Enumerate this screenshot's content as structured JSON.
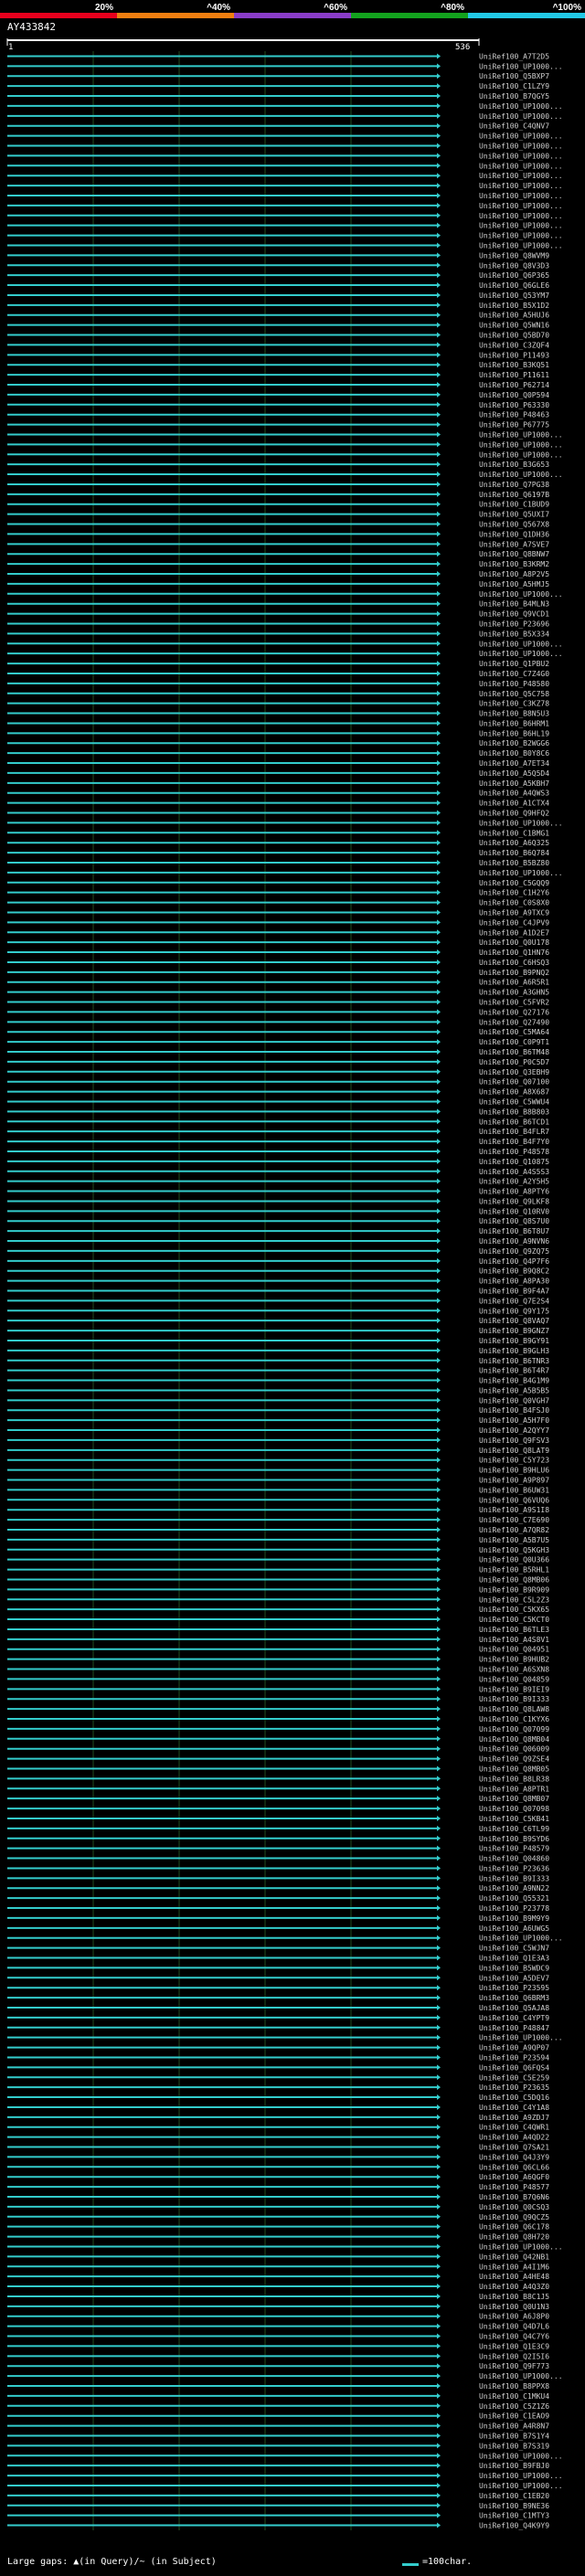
{
  "header": {
    "query_name": "AY433842",
    "scale_ticks": [
      "20%",
      "^40%",
      "^60%",
      "^80%",
      "^100%"
    ],
    "scale_colors": [
      "#e8001d",
      "#f07f10",
      "#8a3cc8",
      "#13a31e",
      "#22c9e6"
    ],
    "ruler_start": "1",
    "ruler_end": "536"
  },
  "legend": {
    "text": "Large gaps: ▲(in Query)/~ (in Subject)",
    "scale_label": "=100char."
  },
  "hits": [
    "UniRef100_A7T2D5",
    "UniRef100_UP1000...",
    "UniRef100_Q5BXP7",
    "UniRef100_C1LZY9",
    "UniRef100_B7QGY5",
    "UniRef100_UP1000...",
    "UniRef100_UP1000...",
    "UniRef100_C4QNV7",
    "UniRef100_UP1000...",
    "UniRef100_UP1000...",
    "UniRef100_UP1000...",
    "UniRef100_UP1000...",
    "UniRef100_UP1000...",
    "UniRef100_UP1000...",
    "UniRef100_UP1000...",
    "UniRef100_UP1000...",
    "UniRef100_UP1000...",
    "UniRef100_UP1000...",
    "UniRef100_UP1000...",
    "UniRef100_UP1000...",
    "UniRef100_Q8WVM9",
    "UniRef100_Q8V3D3",
    "UniRef100_Q6P365",
    "UniRef100_Q6GLE6",
    "UniRef100_Q53YM7",
    "UniRef100_B5X1D2",
    "UniRef100_A5HUJ6",
    "UniRef100_Q5WN16",
    "UniRef100_Q5BD70",
    "UniRef100_C3ZQF4",
    "UniRef100_P11493",
    "UniRef100_B3KQ51",
    "UniRef100_P11611",
    "UniRef100_P62714",
    "UniRef100_Q0P594",
    "UniRef100_P63330",
    "UniRef100_P48463",
    "UniRef100_P67775",
    "UniRef100_UP1000...",
    "UniRef100_UP1000...",
    "UniRef100_UP1000...",
    "UniRef100_B3G653",
    "UniRef100_UP1000...",
    "UniRef100_Q7PG38",
    "UniRef100_Q6197B",
    "UniRef100_C1BUD9",
    "UniRef100_Q5UXI7",
    "UniRef100_Q567X8",
    "UniRef100_Q1DH36",
    "UniRef100_A7SVE7",
    "UniRef100_Q8BNW7",
    "UniRef100_B3KRM2",
    "UniRef100_A8P2V5",
    "UniRef100_A5HMJ5",
    "UniRef100_UP1000...",
    "UniRef100_B4MLN3",
    "UniRef100_Q9VCD1",
    "UniRef100_P23696",
    "UniRef100_B5X334",
    "UniRef100_UP1000...",
    "UniRef100_UP1000...",
    "UniRef100_Q1PBU2",
    "UniRef100_C7Z4G0",
    "UniRef100_P48580",
    "UniRef100_Q5C758",
    "UniRef100_C3KZ78",
    "UniRef100_B8N5U3",
    "UniRef100_B6HRM1",
    "UniRef100_B6HL19",
    "UniRef100_B2WGG6",
    "UniRef100_B0Y8C6",
    "UniRef100_A7ET34",
    "UniRef100_A5Q5D4",
    "UniRef100_A5KBH7",
    "UniRef100_A4QWS3",
    "UniRef100_A1CTX4",
    "UniRef100_Q9HFQ2",
    "UniRef100_UP1000...",
    "UniRef100_C1BMG1",
    "UniRef100_A6Q325",
    "UniRef100_B6Q784",
    "UniRef100_B5BZ80",
    "UniRef100_UP1000...",
    "UniRef100_C5GQQ9",
    "UniRef100_C1H2Y6",
    "UniRef100_C0S8X0",
    "UniRef100_A9TXC9",
    "UniRef100_C4JPV9",
    "UniRef100_A1D2E7",
    "UniRef100_Q0U178",
    "UniRef100_Q1HN76",
    "UniRef100_C6HSQ3",
    "UniRef100_B9PNQ2",
    "UniRef100_A6R5R1",
    "UniRef100_A3GHN5",
    "UniRef100_C5FVR2",
    "UniRef100_Q27176",
    "UniRef100_Q27490",
    "UniRef100_C5MA64",
    "UniRef100_C0P9T1",
    "UniRef100_B6TM48",
    "UniRef100_P0C5D7",
    "UniRef100_Q3EBH9",
    "UniRef100_Q07100",
    "UniRef100_A8X687",
    "UniRef100_C5WWU4",
    "UniRef100_B8B803",
    "UniRef100_B6TCD1",
    "UniRef100_B4FLR7",
    "UniRef100_B4F7Y0",
    "UniRef100_P48578",
    "UniRef100_Q10875",
    "UniRef100_A4S5S3",
    "UniRef100_A2Y5H5",
    "UniRef100_A8PTY6",
    "UniRef100_Q9LKF8",
    "UniRef100_Q10RV0",
    "UniRef100_Q8S7U0",
    "UniRef100_B6T8U7",
    "UniRef100_A9NVN6",
    "UniRef100_Q9ZQ75",
    "UniRef100_Q4P7F6",
    "UniRef100_B9Q8C2",
    "UniRef100_A8PA30",
    "UniRef100_B9F4A7",
    "UniRef100_Q7E2S4",
    "UniRef100_Q9Y175",
    "UniRef100_Q8VAQ7",
    "UniRef100_B9GNZ7",
    "UniRef100_B9GY91",
    "UniRef100_B9GLH3",
    "UniRef100_B6TNR3",
    "UniRef100_B6T4R7",
    "UniRef100_B4G1M9",
    "UniRef100_A5B5B5",
    "UniRef100_Q0VGH7",
    "UniRef100_B4FSJ0",
    "UniRef100_A5H7F0",
    "UniRef100_A2QYY7",
    "UniRef100_Q9FSV3",
    "UniRef100_Q8LAT9",
    "UniRef100_C5Y723",
    "UniRef100_B9HLU6",
    "UniRef100_A9P897",
    "UniRef100_B6UW31",
    "UniRef100_Q6VUQ6",
    "UniRef100_A9S1I8",
    "UniRef100_C7E690",
    "UniRef100_A7QR82",
    "UniRef100_A5B7U5",
    "UniRef100_Q5KGH3",
    "UniRef100_Q0U366",
    "UniRef100_B5RHL1",
    "UniRef100_Q8MB06",
    "UniRef100_B9R909",
    "UniRef100_C5L2Z3",
    "UniRef100_C5KX65",
    "UniRef100_C5KCT0",
    "UniRef100_B6TLE3",
    "UniRef100_A4S8V1",
    "UniRef100_Q04951",
    "UniRef100_B9HUB2",
    "UniRef100_A6SXN8",
    "UniRef100_Q04859",
    "UniRef100_B9IEI9",
    "UniRef100_B9I333",
    "UniRef100_Q8LAW8",
    "UniRef100_C1KYX6",
    "UniRef100_Q07099",
    "UniRef100_Q8MB04",
    "UniRef100_Q06009",
    "UniRef100_Q9ZSE4",
    "UniRef100_Q8MB05",
    "UniRef100_B8LR38",
    "UniRef100_A8PTR1",
    "UniRef100_Q8MB07",
    "UniRef100_Q07098",
    "UniRef100_C5KB41",
    "UniRef100_C6TL99",
    "UniRef100_B9SYD6",
    "UniRef100_P48579",
    "UniRef100_Q04860",
    "UniRef100_P23636",
    "UniRef100_B9I333",
    "UniRef100_A9NN22",
    "UniRef100_Q55321",
    "UniRef100_P23778",
    "UniRef100_B9M9Y9",
    "UniRef100_A6UWG5",
    "UniRef100_UP1000...",
    "UniRef100_C5WJN7",
    "UniRef100_Q1E3A3",
    "UniRef100_B5WDC9",
    "UniRef100_A5DEV7",
    "UniRef100_P23595",
    "UniRef100_Q6BRM3",
    "UniRef100_Q5AJA8",
    "UniRef100_C4YPT9",
    "UniRef100_P48847",
    "UniRef100_UP1000...",
    "UniRef100_A9QP07",
    "UniRef100_P23594",
    "UniRef100_Q6FQS4",
    "UniRef100_C5E259",
    "UniRef100_P23635",
    "UniRef100_C5DQ16",
    "UniRef100_C4Y1A8",
    "UniRef100_A9ZDJ7",
    "UniRef100_C4QWR1",
    "UniRef100_A4QD22",
    "UniRef100_Q7SA21",
    "UniRef100_Q4J3Y9",
    "UniRef100_Q6CL66",
    "UniRef100_A6QGF0",
    "UniRef100_P48577",
    "UniRef100_B7Q6N6",
    "UniRef100_Q0CSQ3",
    "UniRef100_Q9QCZ5",
    "UniRef100_Q6C178",
    "UniRef100_Q8H720",
    "UniRef100_UP1000...",
    "UniRef100_Q42NB1",
    "UniRef100_A4I1M6",
    "UniRef100_A4HE48",
    "UniRef100_A4Q3Z0",
    "UniRef100_B8C1J5",
    "UniRef100_Q0U1N3",
    "UniRef100_A6J8P0",
    "UniRef100_Q4D7L6",
    "UniRef100_Q4C7Y6",
    "UniRef100_Q1E3C9",
    "UniRef100_Q2I5I6",
    "UniRef100_Q9F773",
    "UniRef100_UP1000...",
    "UniRef100_B8PPX8",
    "UniRef100_C1MKU4",
    "UniRef100_C5Z1Z6",
    "UniRef100_C1EAO9",
    "UniRef100_A4R8N7",
    "UniRef100_B7S1Y4",
    "UniRef100_B7S319",
    "UniRef100_UP1000...",
    "UniRef100_B9FBJ0",
    "UniRef100_UP1000...",
    "UniRef100_UP1000...",
    "UniRef100_C1EB20",
    "UniRef100_B9NE36",
    "UniRef100_C1MTY3",
    "UniRef100_Q4K9Y9"
  ]
}
